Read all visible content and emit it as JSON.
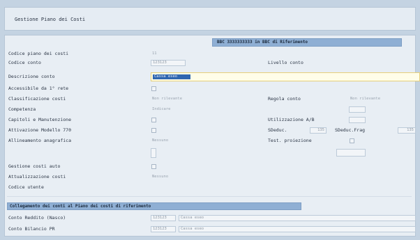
{
  "window": {
    "title": "Gestione Piano dei Costi"
  },
  "reference_header": "BBC 3333333333 in BBC di Riferimento",
  "fields": [
    {
      "key": "cod_piano",
      "label": "Codice piano dei costi",
      "value": "11"
    },
    {
      "key": "cod_conto",
      "label": "Codice conto",
      "value": "123123"
    },
    {
      "key": "livello",
      "label": "Livello conto",
      "value": ""
    },
    {
      "key": "descrizione",
      "label": "Descrizione conto",
      "value": "Cassa eseo"
    },
    {
      "key": "accessibile",
      "label": "Accessibile da 1° rete",
      "value": ""
    },
    {
      "key": "classificazione",
      "label": "Classificazione costi",
      "value": "Non rilevante"
    },
    {
      "key": "regola",
      "label": "Regola conto",
      "value": "Non rilevante"
    },
    {
      "key": "competenza",
      "label": "Competenza",
      "value": "Indicare"
    },
    {
      "key": "capitoli",
      "label": "Capitoli e Manutenzione",
      "value": ""
    },
    {
      "key": "utilizzazione",
      "label": "Utilizzazione A/B",
      "value": ""
    },
    {
      "key": "modello",
      "label": "Attivazione Modello 770",
      "value": ""
    },
    {
      "key": "sdeduc",
      "label": "SDeduc.",
      "value": "135"
    },
    {
      "key": "sdeduc_frag",
      "label": "SDeduc.Frag",
      "value": "135"
    },
    {
      "key": "allineamento",
      "label": "Allineamento anagrafica",
      "value": "Nessuno"
    },
    {
      "key": "tipo_proiezione",
      "label": "Test. proiezione",
      "value": ""
    },
    {
      "key": "gestione_auto",
      "label": "Gestione costi auto",
      "value": ""
    },
    {
      "key": "attualizzazione",
      "label": "Attualizzazione costi",
      "value": "Nessuno"
    },
    {
      "key": "codice_utente",
      "label": "Codice utente",
      "value": ""
    }
  ],
  "section_title": "Collegamento dei conti al Piano dei costi di riferimento",
  "reference_rows": [
    {
      "label": "Conto Reddito (Nasco)",
      "code": "123123",
      "desc": "Cassa eseo"
    },
    {
      "label": "Conto Bilancio PR",
      "code": "123123",
      "desc": "Cassa eseo"
    }
  ]
}
